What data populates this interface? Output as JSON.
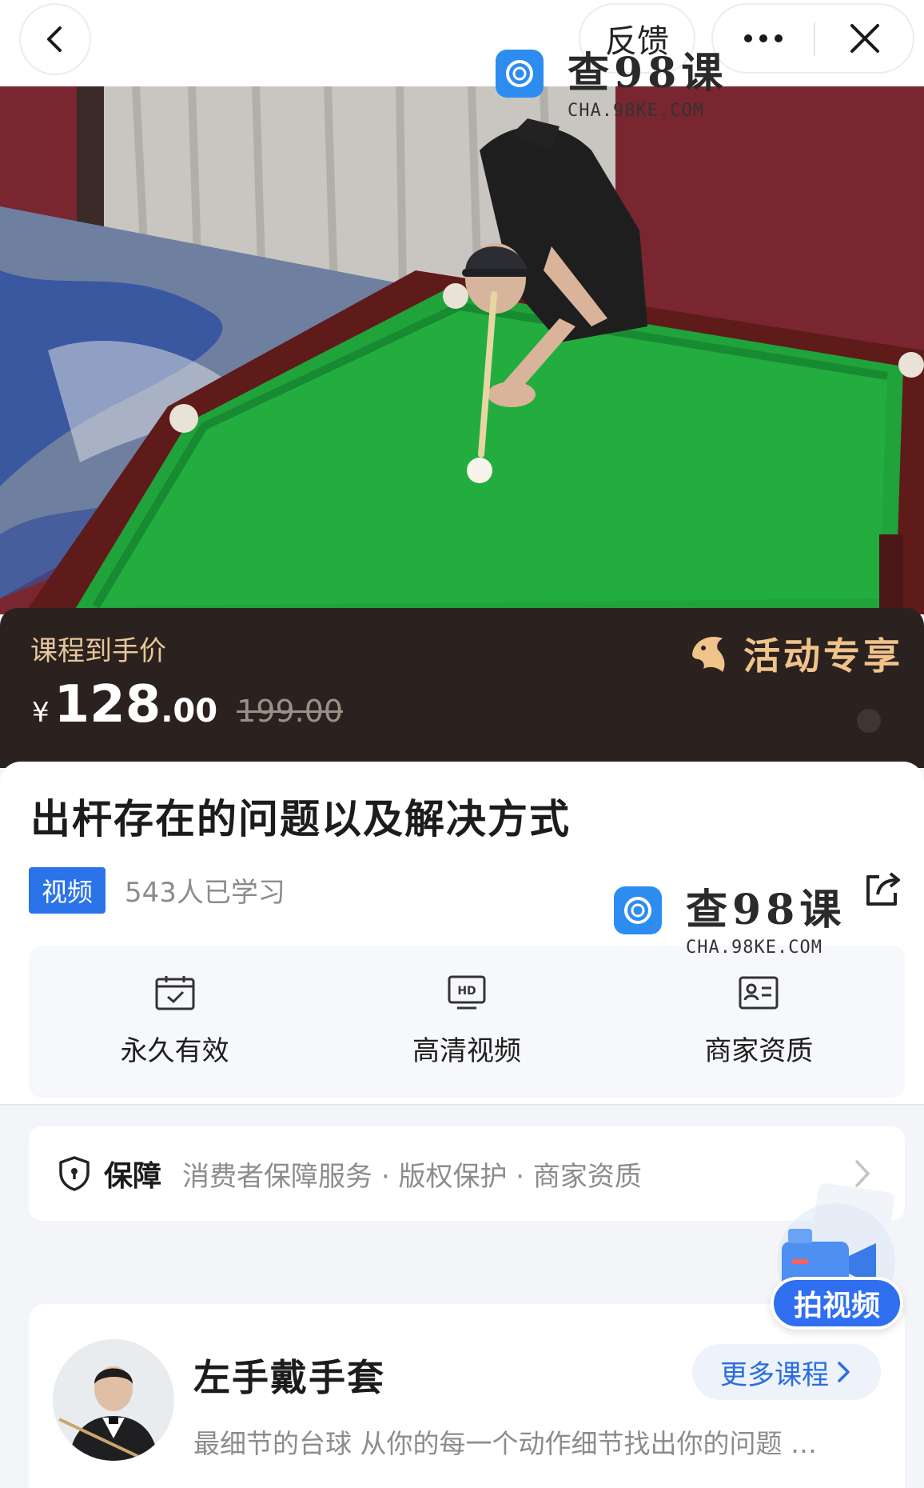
{
  "topbar": {
    "feedback_label": "反馈"
  },
  "watermark": {
    "title": "查98课",
    "subtitle": "CHA.98KE.COM"
  },
  "price": {
    "label": "课程到手价",
    "currency": "¥",
    "integer": "128",
    "decimal": ".00",
    "original": "199.00",
    "promo_label": "活动专享"
  },
  "course": {
    "title": "出杆存在的问题以及解决方式",
    "tag": "视频",
    "learners": "543人已学习"
  },
  "features": [
    {
      "icon": "calendar-check-icon",
      "label": "永久有效"
    },
    {
      "icon": "hd-video-icon",
      "label": "高清视频"
    },
    {
      "icon": "id-card-icon",
      "label": "商家资质"
    }
  ],
  "guarantee": {
    "title": "保障",
    "items": "消费者保障服务 · 版权保护 · 商家资质"
  },
  "teacher": {
    "name": "左手戴手套",
    "more_label": "更多课程",
    "description": "最细节的台球 从你的每一个动作细节找出你的问题 …"
  },
  "float_button": {
    "label": "拍视频"
  },
  "colors": {
    "accent_blue": "#2b73e8",
    "price_gold": "#e8c79a",
    "banner_bg": "#2b2220",
    "table_green": "#1fa33a"
  }
}
